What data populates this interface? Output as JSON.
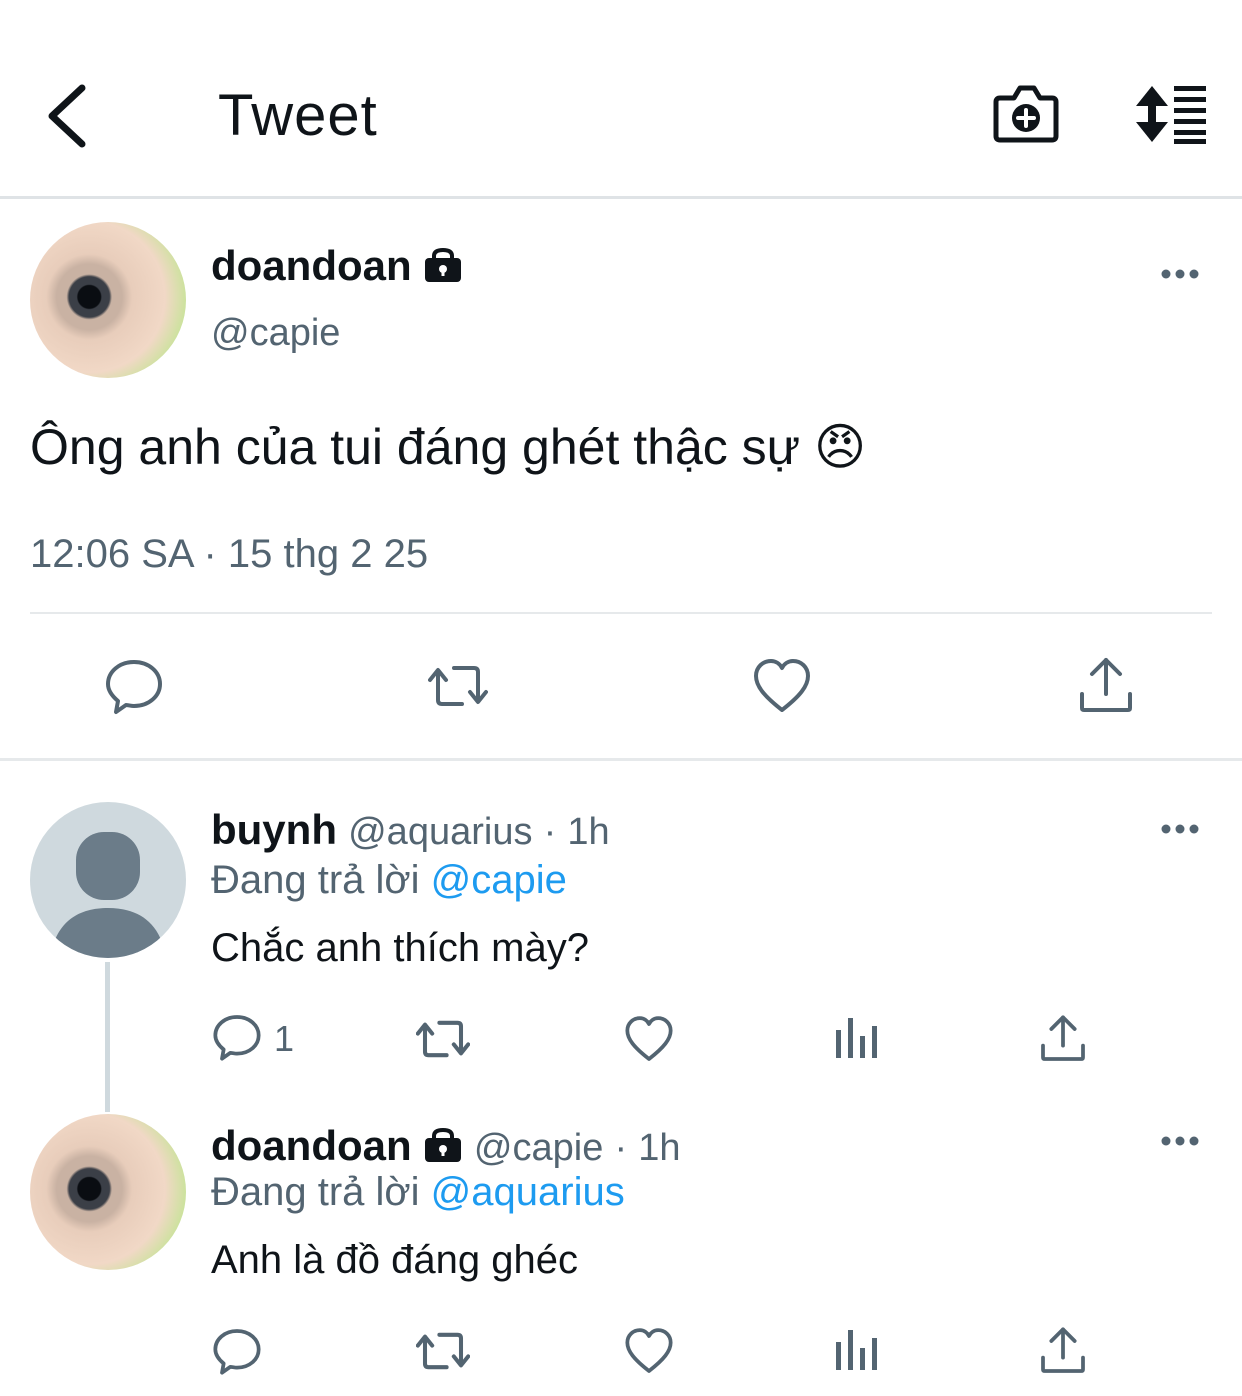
{
  "header": {
    "title": "Tweet"
  },
  "main_tweet": {
    "name": "doandoan",
    "handle": "@capie",
    "text": "Ông anh của tui đáng ghét thậc sự 😠",
    "time": "12:06 SA · 15 thg 2 25"
  },
  "replies": [
    {
      "name": "buynh",
      "handle": "@aquarius",
      "time_sep": "·",
      "time": "1h",
      "replying_to_label": "Đang trả lời",
      "replying_to": "@capie",
      "text": "Chắc anh thích mày?",
      "reply_count": "1"
    },
    {
      "name": "doandoan",
      "handle": "@capie",
      "time_sep": "·",
      "time": "1h",
      "replying_to_label": "Đang trả lời",
      "replying_to": "@aquarius",
      "text": "Anh là đồ đáng ghéc"
    }
  ],
  "icons": {
    "back": "chevron-left-icon",
    "camera": "camera-add-icon",
    "sort": "sort-icon",
    "reply": "reply-icon",
    "retweet": "retweet-icon",
    "like": "heart-icon",
    "views": "analytics-icon",
    "share": "share-icon"
  },
  "colors": {
    "text": "#0f1419",
    "secondary": "#536471",
    "link": "#1d9bf0",
    "divider": "#e6e9eb"
  }
}
